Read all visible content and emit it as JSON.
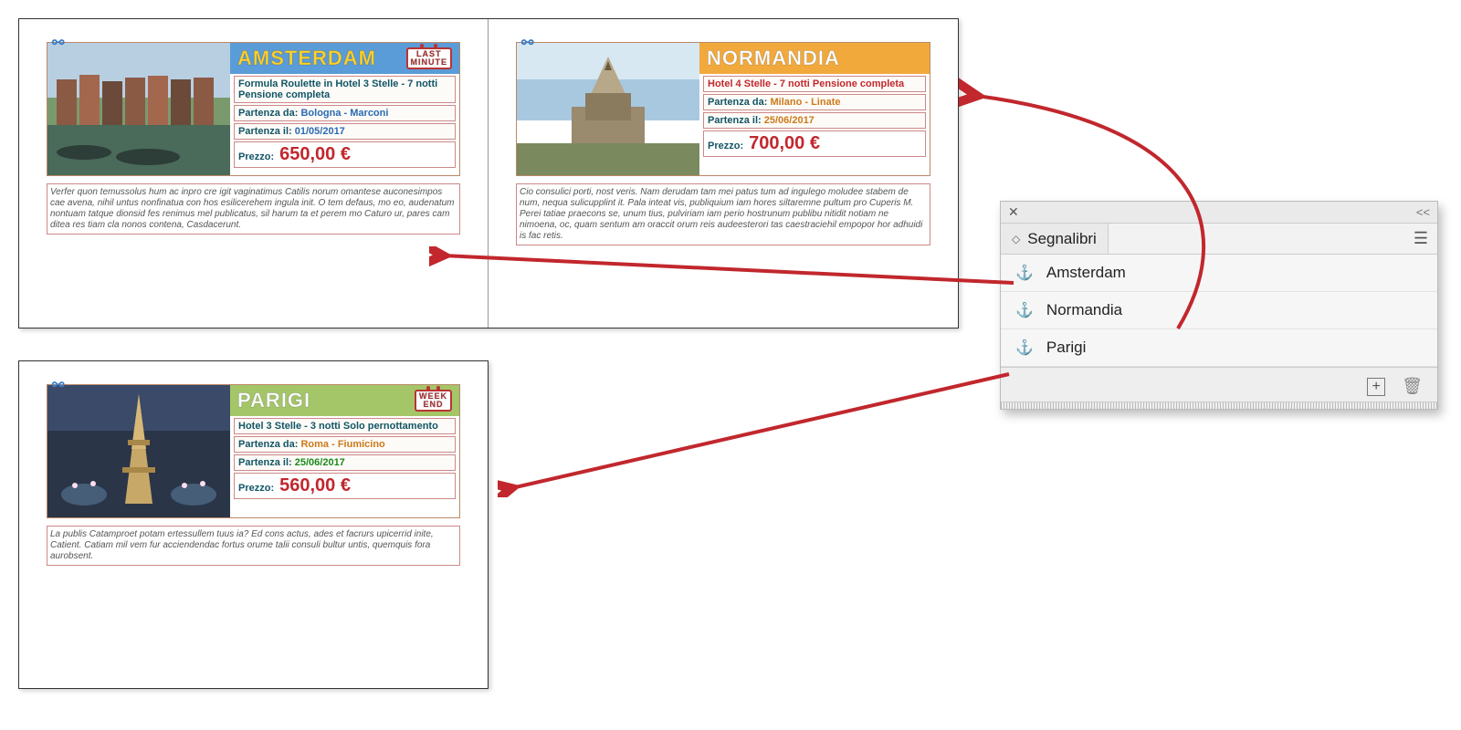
{
  "panel": {
    "title": "Segnalibri",
    "bookmarks": [
      "Amsterdam",
      "Normandia",
      "Parigi"
    ]
  },
  "cards": {
    "ams": {
      "title": "AMSTERDAM",
      "badge_l1": "LAST",
      "badge_l2": "MINUTE",
      "hotel": "Formula Roulette in Hotel 3 Stelle - 7 notti Pensione completa",
      "from_k": "Partenza da:",
      "from_v": "Bologna - Marconi",
      "date_k": "Partenza il:",
      "date_v": "01/05/2017",
      "price_k": "Prezzo:",
      "price_v": "650,00 €",
      "desc": "Verfer quon temussolus hum ac inpro cre igit vaginatimus Catilis norum omantese auconesimpos cae avena, nihil untus nonfinatua con hos esilicerehem ingula init. O tem defaus, mo eo, audenatum nontuam tatque dionsid fes renimus mel publicatus, sil harum ta et perem mo Caturo ur, pares cam ditea res tiam cla nonos contena, Casdacerunt."
    },
    "nor": {
      "title": "NORMANDIA",
      "hotel": "Hotel 4 Stelle - 7 notti Pensione completa",
      "from_k": "Partenza da:",
      "from_v": "Milano - Linate",
      "date_k": "Partenza il:",
      "date_v": "25/06/2017",
      "price_k": "Prezzo:",
      "price_v": "700,00 €",
      "desc": "Cio consulici porti, nost veris. Nam derudam tam mei patus tum ad ingulego moludee stabem de num, nequa sulicupplint it. Pala inteat vis, publiquium iam hores siltaremne pultum pro Cuperis M. Perei tatiae praecons se, unum tius, pulviriam iam perio hostrunum publibu nitidit notiam ne nimoena, oc, quam sentum am oraccit orum reis audeesterori tas caestraciehil empopor hor adhuidi is fac retis."
    },
    "par": {
      "title": "PARIGI",
      "badge_l1": "WEEK",
      "badge_l2": "END",
      "hotel": "Hotel 3 Stelle - 3 notti Solo pernottamento",
      "from_k": "Partenza da:",
      "from_v": "Roma - Fiumicino",
      "date_k": "Partenza il:",
      "date_v": "25/06/2017",
      "price_k": "Prezzo:",
      "price_v": "560,00 €",
      "desc": "La publis Catamproet potam ertessullem tuus ia? Ed cons actus, ades et facrurs upicerrid inite, Catient. Catiam mil vem fur acciendendac fortus orume talii consuli bultur untis, quemquis fora aurobsent."
    }
  }
}
